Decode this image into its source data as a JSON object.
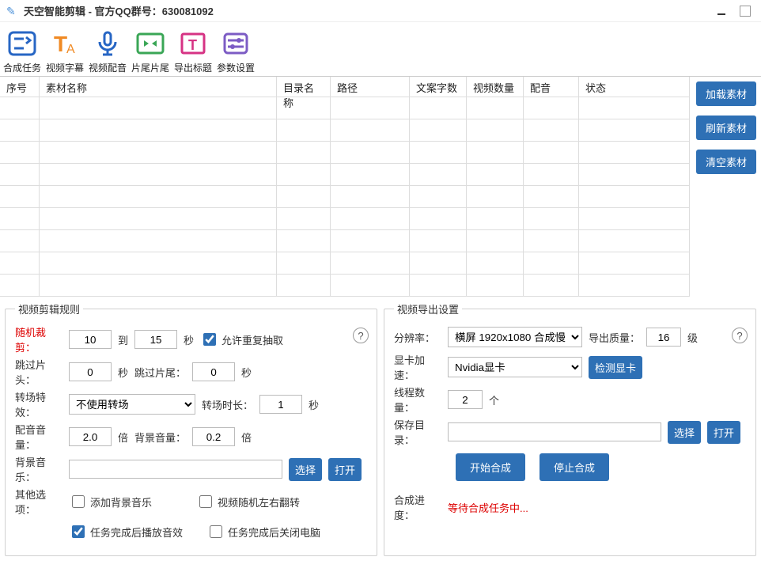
{
  "window": {
    "title": "天空智能剪辑 - 官方QQ群号：630081092"
  },
  "toolbar": {
    "items": [
      {
        "id": "compose",
        "label": "合成任务"
      },
      {
        "id": "subtitle",
        "label": "视频字幕"
      },
      {
        "id": "dub",
        "label": "视频配音"
      },
      {
        "id": "clip",
        "label": "片尾片尾"
      },
      {
        "id": "title",
        "label": "导出标题"
      },
      {
        "id": "param",
        "label": "参数设置"
      }
    ]
  },
  "grid": {
    "headers": [
      "序号",
      "素材名称",
      "目录名称",
      "路径",
      "文案字数",
      "视频数量",
      "配音",
      "状态"
    ]
  },
  "sidebtns": {
    "load": "加载素材",
    "refresh": "刷新素材",
    "clear": "清空素材"
  },
  "editRules": {
    "legend": "视频剪辑规则",
    "randomCut": "随机裁剪：",
    "randomCutFrom": "10",
    "to": "到",
    "randomCutTo": "15",
    "sec": "秒",
    "allowRepeat": "允许重复抽取",
    "skipHead": "跳过片头：",
    "skipHeadVal": "0",
    "skipTail": "跳过片尾：",
    "skipTailVal": "0",
    "transFx": "转场特效：",
    "transFxOpt": "不使用转场",
    "transDur": "转场时长：",
    "transDurVal": "1",
    "dubVol": "配音音量：",
    "dubVolVal": "2.0",
    "times": "倍",
    "bgVol": "背景音量：",
    "bgVolVal": "0.2",
    "bgMusic": "背景音乐：",
    "bgMusicVal": "",
    "choose": "选择",
    "open": "打开",
    "other": "其他选项：",
    "addBgm": "添加背景音乐",
    "randomFlip": "视频随机左右翻转",
    "playSoundDone": "任务完成后播放音效",
    "shutdownDone": "任务完成后关闭电脑"
  },
  "exportSet": {
    "legend": "视频导出设置",
    "res": "分辨率：",
    "resOpt": "横屏 1920x1080 合成慢",
    "quality": "导出质量：",
    "qualityVal": "16",
    "level": "级",
    "gpu": "显卡加速：",
    "gpuOpt": "Nvidia显卡",
    "detectGpu": "检测显卡",
    "threads": "线程数量：",
    "threadsVal": "2",
    "unitGe": "个",
    "saveDir": "保存目录：",
    "saveDirVal": "",
    "choose": "选择",
    "open": "打开",
    "start": "开始合成",
    "stop": "停止合成",
    "progress": "合成进度：",
    "progressStatus": "等待合成任务中..."
  }
}
